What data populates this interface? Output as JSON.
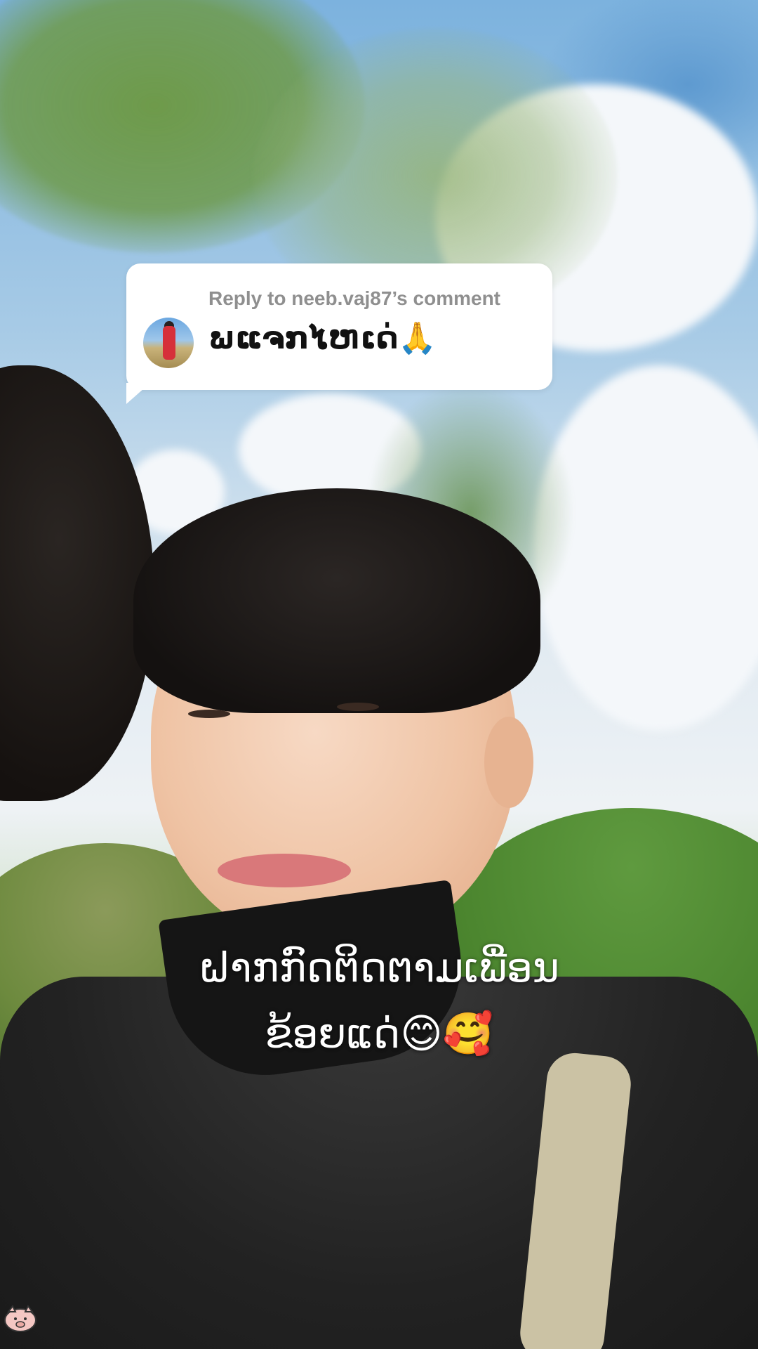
{
  "reply": {
    "header": "Reply to neeb.vaj87’s comment",
    "comment_text": "ພແຈກໄຫເດ່🙏"
  },
  "caption": {
    "line1": "ຝາກກົດຕິດຕາມເພື່ອນ",
    "line2": "ຂ້ອຍແດ່😊🥰"
  },
  "icons": {
    "corner": "pig-sticker-icon"
  }
}
